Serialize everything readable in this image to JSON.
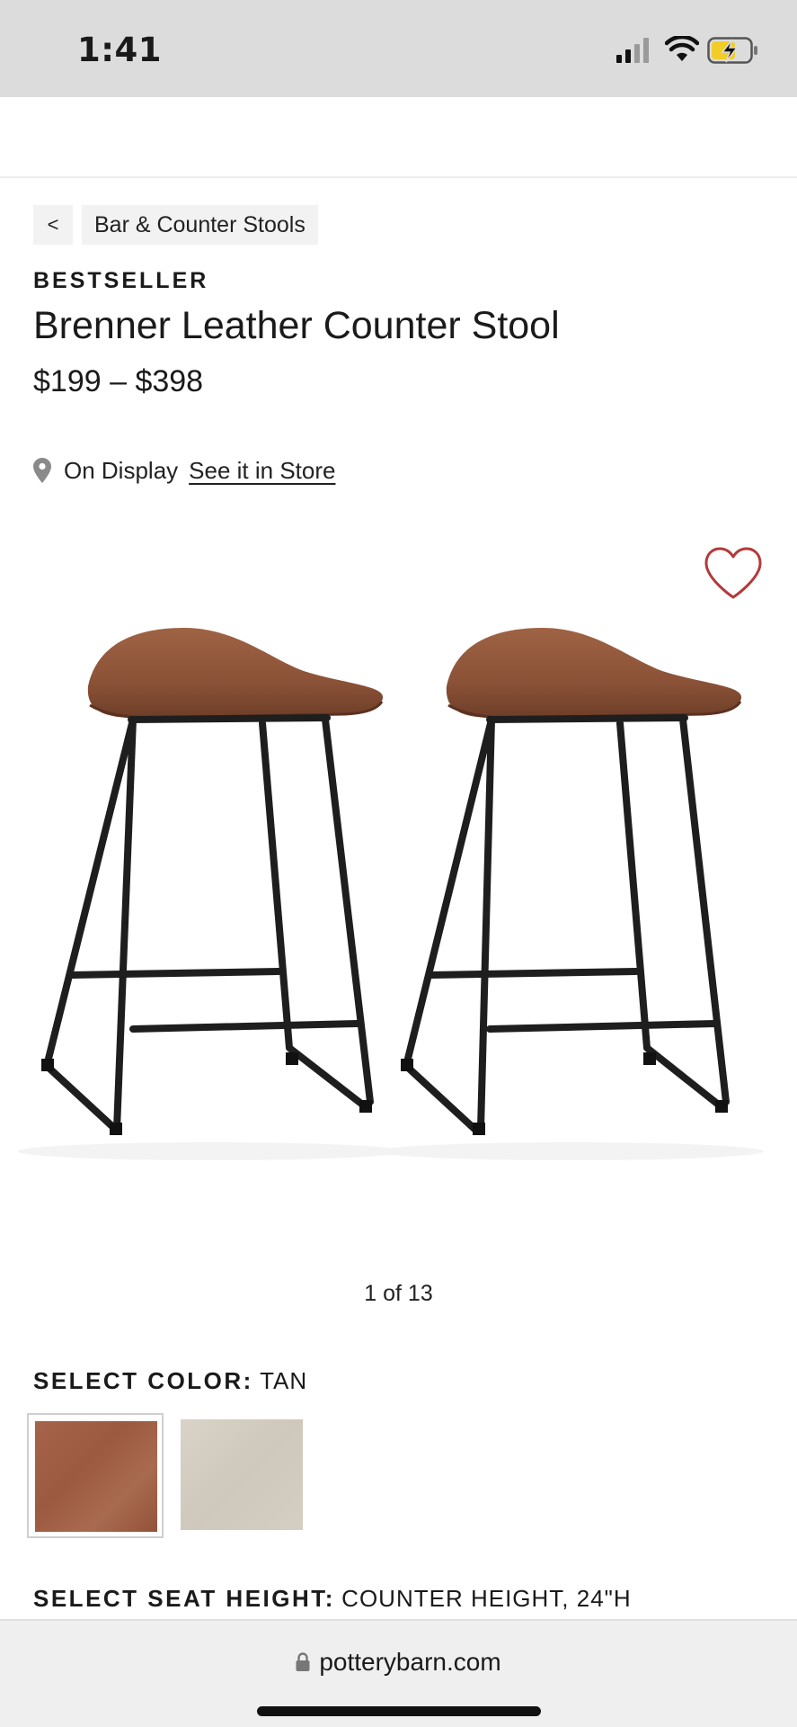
{
  "status_bar": {
    "time": "1:41",
    "icons": [
      "signal-icon",
      "wifi-icon",
      "battery-charging-icon"
    ]
  },
  "breadcrumb": {
    "back_label": "<",
    "category_label": "Bar & Counter Stools"
  },
  "product": {
    "badge": "BESTSELLER",
    "title": "Brenner Leather Counter Stool",
    "price": "$199 – $398",
    "display_status": "On Display",
    "store_link": "See it in Store",
    "image_counter": "1 of 13",
    "wishlist_icon": "heart-outline-icon",
    "accent_color": "#b33a3a"
  },
  "color_selector": {
    "label": "SELECT COLOR:",
    "selected_value": "TAN",
    "swatches": [
      {
        "name": "tan",
        "color": "#a0603f",
        "selected": true
      },
      {
        "name": "taupe",
        "color": "#d3cdc2",
        "selected": false
      }
    ]
  },
  "seat_height_selector": {
    "label": "SELECT SEAT HEIGHT:",
    "selected_value": "COUNTER HEIGHT, 24\"H"
  },
  "browser": {
    "url": "potterybarn.com"
  }
}
